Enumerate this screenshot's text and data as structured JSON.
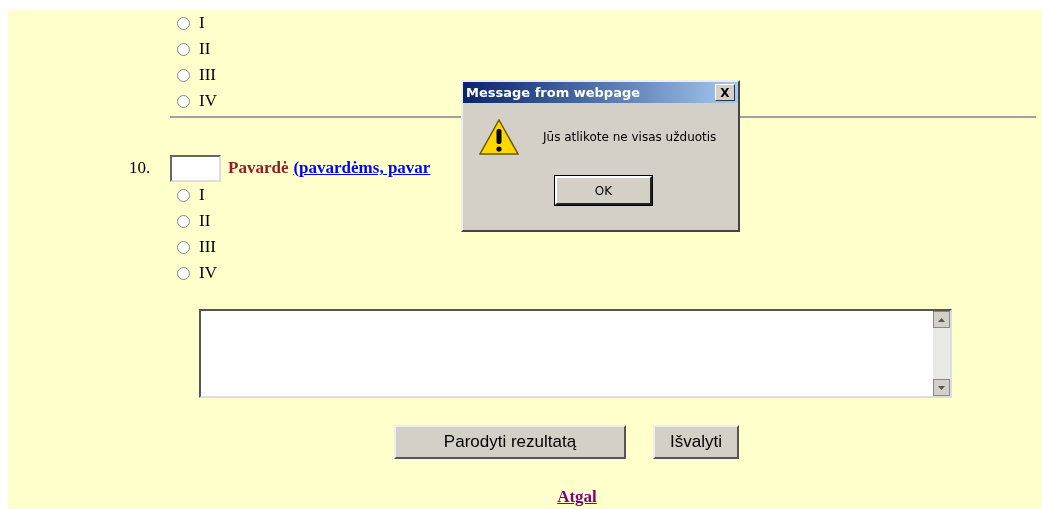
{
  "question_prev": {
    "options": [
      {
        "label": "I",
        "selected": false
      },
      {
        "label": "II",
        "selected": false
      },
      {
        "label": "III",
        "selected": false
      },
      {
        "label": "IV",
        "selected": false
      }
    ]
  },
  "question_10": {
    "number": "10.",
    "label": "Pavardė",
    "link": "(pavardėms, pavar",
    "options": [
      {
        "label": "I",
        "selected": false
      },
      {
        "label": "II",
        "selected": false
      },
      {
        "label": "III",
        "selected": false
      },
      {
        "label": "IV",
        "selected": false
      }
    ]
  },
  "buttons": [
    {
      "label": "Parodyti rezultatą",
      "kind": "wide"
    },
    {
      "label": "Išvalyti",
      "kind": "narrow"
    }
  ],
  "back_link": "Atgal",
  "dialog": {
    "title": "Message from webpage",
    "close": "X",
    "message": "Jūs atlikote ne visas užduotis",
    "ok": "OK"
  }
}
